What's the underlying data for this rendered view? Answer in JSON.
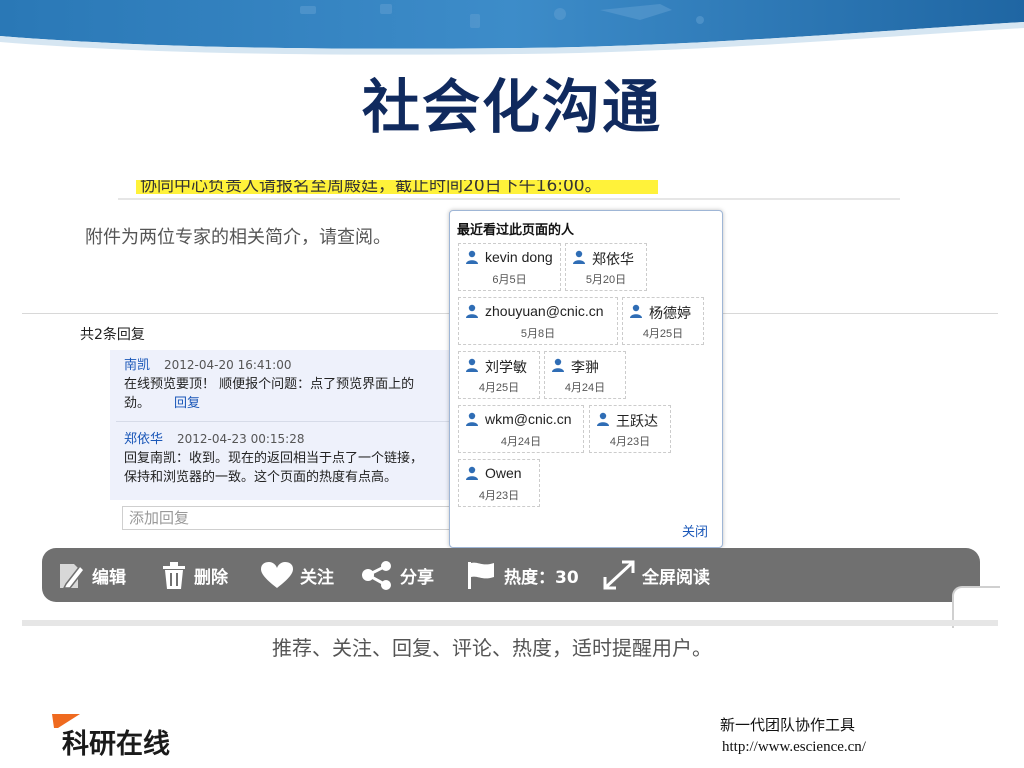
{
  "slide": {
    "title": "社会化沟通",
    "caption": "推荐、关注、回复、评论、热度，适时提醒用户。",
    "logo_text": "科研在线",
    "footer_tagline": "新一代团队协作工具",
    "footer_url": "http://www.escience.cn/"
  },
  "page": {
    "attachment_note": "附件为两位专家的相关简介，请查阅。",
    "cut_line_text": "协同中心负责人请报名至周殿廷，截止时间20日下午16:00。",
    "reply_count": "共2条回复",
    "comments": [
      {
        "author": "南凯",
        "time": "2012-04-20 16:41:00",
        "line1": "在线预览要顶！ 顺便报个问题：点了预览界面上的",
        "line2": "劲。",
        "reply_link": "回复"
      },
      {
        "author": "郑依华",
        "time": "2012-04-23 00:15:28",
        "line1": "回复南凯：收到。现在的返回相当于点了一个链接，",
        "line2": "保持和浏览器的一致。这个页面的热度有点高。"
      }
    ],
    "reply_placeholder": "添加回复"
  },
  "popup": {
    "title": "最近看过此页面的人",
    "viewers": [
      {
        "name": "kevin dong",
        "date": "6月5日"
      },
      {
        "name": "郑依华",
        "date": "5月20日"
      },
      {
        "name": "zhouyuan@cnic.cn",
        "date": "5月8日"
      },
      {
        "name": "杨德婷",
        "date": "4月25日"
      },
      {
        "name": "刘学敏",
        "date": "4月25日"
      },
      {
        "name": "李翀",
        "date": "4月24日"
      },
      {
        "name": "wkm@cnic.cn",
        "date": "4月24日"
      },
      {
        "name": "王跃达",
        "date": "4月23日"
      },
      {
        "name": "Owen",
        "date": "4月23日"
      }
    ],
    "close_label": "关闭"
  },
  "toolbar": {
    "edit": "编辑",
    "delete": "删除",
    "follow": "关注",
    "share": "分享",
    "heat": "热度：30",
    "fullscreen": "全屏阅读"
  },
  "icons": {
    "user": "user-icon",
    "edit": "pencil-icon",
    "delete": "trash-icon",
    "follow": "heart-icon",
    "share": "share-icon",
    "heat": "flag-icon",
    "fullscreen": "expand-icon"
  },
  "colors": {
    "title": "#102a5e",
    "banner": "#1e6aa8",
    "link": "#1a57b8",
    "toolbar_bg": "#707070",
    "highlight": "#fff23a",
    "logo_accent": "#ef6a1f"
  }
}
